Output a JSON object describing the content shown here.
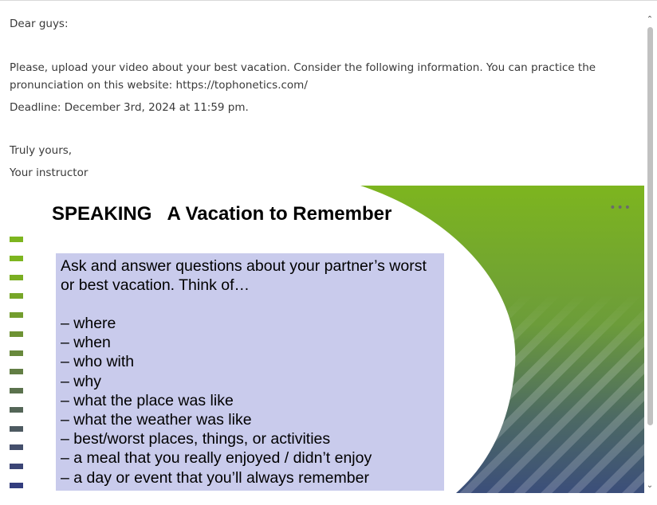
{
  "email": {
    "greeting": "Dear guys:",
    "body_line1": "Please, upload your video about your best vacation. Consider the following information. You can practice the",
    "body_line2": "pronunciation on this website: https://tophonetics.com/",
    "deadline": "Deadline: December 3rd, 2024 at 11:59 pm.",
    "closing": "Truly yours,",
    "signature": "Your instructor"
  },
  "slide": {
    "title": "SPEAKING   A Vacation to Remember",
    "intro": "Ask and answer questions about your partner’s worst or best vacation. Think of…",
    "items": [
      "– where",
      "– when",
      "– who with",
      "– why",
      "– what the place was like",
      "– what the weather was like",
      "– best/worst places, things, or activities",
      "– a meal that you really enjoyed / didn’t enjoy",
      "– a day or event that you’ll always remember"
    ],
    "more_icon": "more-horizontal-icon",
    "colors": {
      "green": "#7db51f",
      "navy": "#2e3f7a",
      "box": "#c9cbec"
    }
  }
}
